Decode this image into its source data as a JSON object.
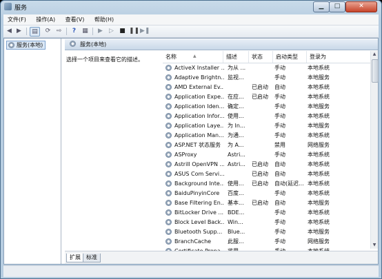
{
  "window": {
    "title": "服务",
    "min": "▁",
    "max": "□",
    "close": "✕"
  },
  "menu": [
    "文件(F)",
    "操作(A)",
    "查看(V)",
    "帮助(H)"
  ],
  "toolbar_icons": [
    "back-arrow-icon",
    "forward-arrow-icon",
    "show-console-tree-icon",
    "refresh-icon",
    "export-list-icon",
    "help-icon",
    "properties-icon",
    "start-service-icon",
    "start-service-alt-icon",
    "stop-service-icon",
    "pause-service-icon",
    "restart-service-icon"
  ],
  "tree": {
    "root": "服务(本地)"
  },
  "panel": {
    "header": "服务(本地)",
    "description": "选择一个项目来查看它的描述。"
  },
  "columns": {
    "name": "名称",
    "desc": "描述",
    "status": "状态",
    "startup": "启动类型",
    "logon": "登录为"
  },
  "rows": [
    {
      "name": "ActiveX Installer ...",
      "desc": "为从 ...",
      "status": "",
      "startup": "手动",
      "logon": "本地系统"
    },
    {
      "name": "Adaptive Brightn...",
      "desc": "监视...",
      "status": "",
      "startup": "手动",
      "logon": "本地服务"
    },
    {
      "name": "AMD External Ev...",
      "desc": "",
      "status": "已启动",
      "startup": "自动",
      "logon": "本地系统"
    },
    {
      "name": "Application Expe...",
      "desc": "在应...",
      "status": "已启动",
      "startup": "手动",
      "logon": "本地系统"
    },
    {
      "name": "Application Iden...",
      "desc": "确定...",
      "status": "",
      "startup": "手动",
      "logon": "本地服务"
    },
    {
      "name": "Application Infor...",
      "desc": "使用...",
      "status": "",
      "startup": "手动",
      "logon": "本地系统"
    },
    {
      "name": "Application Laye...",
      "desc": "为 In...",
      "status": "",
      "startup": "手动",
      "logon": "本地服务"
    },
    {
      "name": "Application Man...",
      "desc": "为通...",
      "status": "",
      "startup": "手动",
      "logon": "本地系统"
    },
    {
      "name": "ASP.NET 状态服务",
      "desc": "为 A...",
      "status": "",
      "startup": "禁用",
      "logon": "网络服务"
    },
    {
      "name": "ASProxy",
      "desc": "Astri...",
      "status": "",
      "startup": "手动",
      "logon": "本地系统"
    },
    {
      "name": "Astrill OpenVPN ...",
      "desc": "Astri...",
      "status": "已启动",
      "startup": "自动",
      "logon": "本地系统"
    },
    {
      "name": "ASUS Com Servi...",
      "desc": "",
      "status": "已启动",
      "startup": "自动",
      "logon": "本地系统"
    },
    {
      "name": "Background Inte...",
      "desc": "使用...",
      "status": "已启动",
      "startup": "自动(延迟...",
      "logon": "本地系统"
    },
    {
      "name": "BaiduPinyinCore",
      "desc": "百度...",
      "status": "",
      "startup": "手动",
      "logon": "本地系统"
    },
    {
      "name": "Base Filtering En...",
      "desc": "基本...",
      "status": "已启动",
      "startup": "自动",
      "logon": "本地服务"
    },
    {
      "name": "BitLocker Drive ...",
      "desc": "BDE...",
      "status": "",
      "startup": "手动",
      "logon": "本地系统"
    },
    {
      "name": "Block Level Back...",
      "desc": "Win...",
      "status": "",
      "startup": "手动",
      "logon": "本地系统"
    },
    {
      "name": "Bluetooth Supp...",
      "desc": "Blue...",
      "status": "",
      "startup": "手动",
      "logon": "本地服务"
    },
    {
      "name": "BranchCache",
      "desc": "此服...",
      "status": "",
      "startup": "手动",
      "logon": "网络服务"
    },
    {
      "name": "Certificate Propa...",
      "desc": "将用...",
      "status": "",
      "startup": "手动",
      "logon": "本地系统"
    }
  ],
  "tabs": [
    "扩展",
    "标准"
  ]
}
